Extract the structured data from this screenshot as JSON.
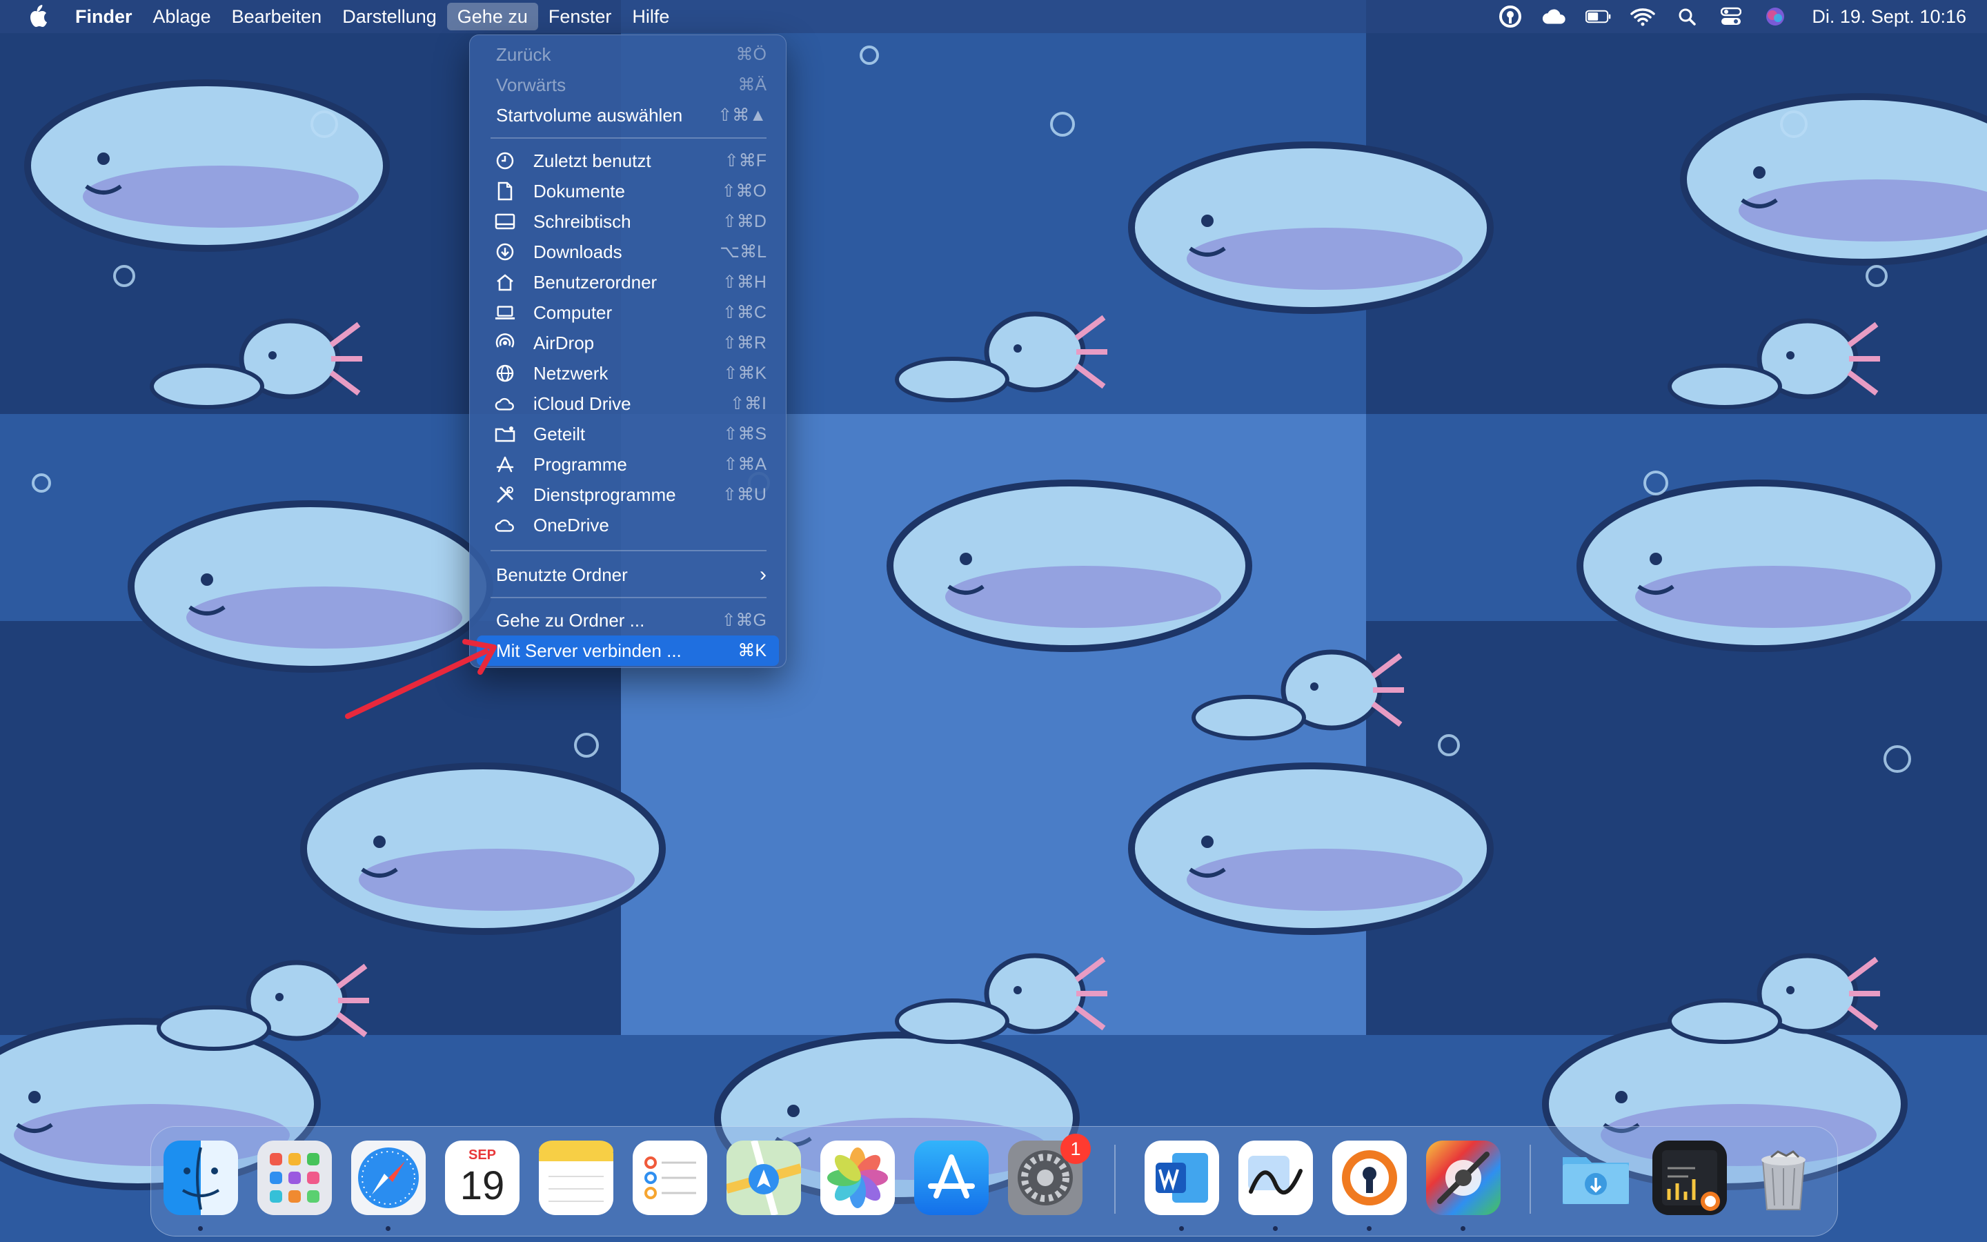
{
  "menubar": {
    "app_name": "Finder",
    "menus": [
      "Ablage",
      "Bearbeiten",
      "Darstellung",
      "Gehe zu",
      "Fenster",
      "Hilfe"
    ],
    "open_menu": "Gehe zu",
    "clock": "Di. 19. Sept.  10:16",
    "status_icons": [
      "vpn-icon",
      "cloud-icon",
      "battery-icon",
      "wifi-icon",
      "search-icon",
      "control-center-icon",
      "siri-icon"
    ]
  },
  "go_menu": {
    "items": [
      {
        "label": "Zurück",
        "shortcut": "⌘Ö",
        "disabled": true,
        "icon": ""
      },
      {
        "label": "Vorwärts",
        "shortcut": "⌘Ä",
        "disabled": true,
        "icon": ""
      },
      {
        "label": "Startvolume auswählen",
        "shortcut": "⇧⌘▲",
        "icon": ""
      },
      {
        "label": "Zuletzt benutzt",
        "shortcut": "⇧⌘F",
        "icon": "clock-icon"
      },
      {
        "label": "Dokumente",
        "shortcut": "⇧⌘O",
        "icon": "document-icon"
      },
      {
        "label": "Schreibtisch",
        "shortcut": "⇧⌘D",
        "icon": "desktop-icon"
      },
      {
        "label": "Downloads",
        "shortcut": "⌥⌘L",
        "icon": "download-icon"
      },
      {
        "label": "Benutzerordner",
        "shortcut": "⇧⌘H",
        "icon": "home-icon"
      },
      {
        "label": "Computer",
        "shortcut": "⇧⌘C",
        "icon": "laptop-icon"
      },
      {
        "label": "AirDrop",
        "shortcut": "⇧⌘R",
        "icon": "airdrop-icon"
      },
      {
        "label": "Netzwerk",
        "shortcut": "⇧⌘K",
        "icon": "globe-icon"
      },
      {
        "label": "iCloud Drive",
        "shortcut": "⇧⌘I",
        "icon": "cloud-icon"
      },
      {
        "label": "Geteilt",
        "shortcut": "⇧⌘S",
        "icon": "shared-folder-icon"
      },
      {
        "label": "Programme",
        "shortcut": "⇧⌘A",
        "icon": "apps-icon"
      },
      {
        "label": "Dienstprogramme",
        "shortcut": "⇧⌘U",
        "icon": "tools-icon"
      },
      {
        "label": "OneDrive",
        "shortcut": "",
        "icon": "cloud-icon"
      },
      {
        "label": "Benutzte Ordner",
        "shortcut": "›",
        "icon": ""
      },
      {
        "label": "Gehe zu Ordner ...",
        "shortcut": "⇧⌘G",
        "icon": ""
      },
      {
        "label": "Mit Server verbinden ...",
        "shortcut": "⌘K",
        "icon": "",
        "highlighted": true
      }
    ]
  },
  "dock": {
    "apps": [
      "finder-icon",
      "launchpad-icon",
      "safari-icon",
      "calendar-icon",
      "notes-icon",
      "reminders-icon",
      "maps-icon",
      "photos-icon",
      "app-store-icon",
      "system-settings-icon",
      "word-icon",
      "freeform-icon",
      "vpn-app-icon",
      "colorsync-icon",
      "downloads-folder-icon",
      "activity-monitor-icon",
      "trash-icon"
    ],
    "calendar": {
      "month": "SEP",
      "day": "19"
    },
    "settings_badge": "1"
  },
  "colors": {
    "highlight": "#1f6fe0",
    "annotation_arrow": "#e8283c",
    "badge": "#ff3b30"
  }
}
